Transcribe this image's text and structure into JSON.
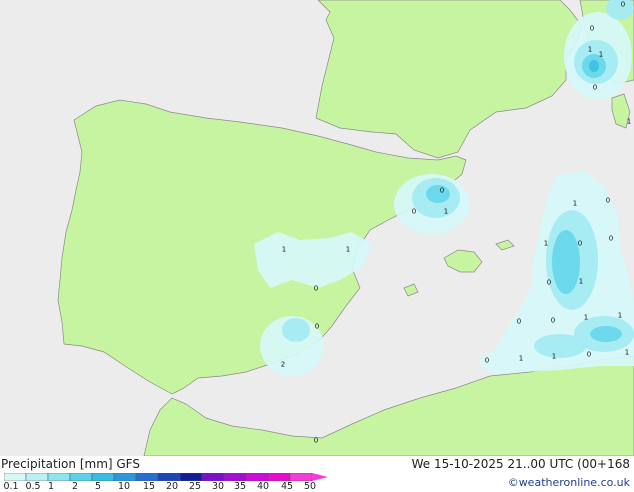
{
  "footer": {
    "title_left": "Precipitation [mm]  GFS",
    "title_right": "We 15-10-2025 21..00 UTC (00+168",
    "copyright": "©weatheronline.co.uk"
  },
  "legend": {
    "ticks": [
      "0.1",
      "0.5",
      "1",
      "2",
      "5",
      "10",
      "15",
      "20",
      "25",
      "30",
      "35",
      "40",
      "45",
      "50"
    ],
    "colors": [
      "#d8f8f8",
      "#b8f0f4",
      "#90e4f0",
      "#5cd2ea",
      "#36bde4",
      "#2c98dc",
      "#2470d0",
      "#1c46b8",
      "#121e96",
      "#7a10c8",
      "#a40ed4",
      "#cc0cd8",
      "#e80ccc",
      "#f43cd8"
    ]
  },
  "map": {
    "colors": {
      "sea": "#ececec",
      "land": "#c6f4a0",
      "border": "#8a8a8a",
      "light_precip": "#d6f7f8",
      "mid_precip": "#a4ebf2",
      "heavy_precip": "#6cd8ec",
      "heaviest_precip": "#3fc2e6"
    },
    "value_labels": [
      "1",
      "0",
      "0",
      "1",
      "1",
      "1",
      "0",
      "0",
      "2",
      "1",
      "0",
      "1",
      "0",
      "0",
      "0",
      "1",
      "0",
      "0",
      "1",
      "1",
      "1",
      "0",
      "1",
      "1",
      "0",
      "1",
      "0",
      "0",
      "1",
      "0",
      "0"
    ]
  }
}
